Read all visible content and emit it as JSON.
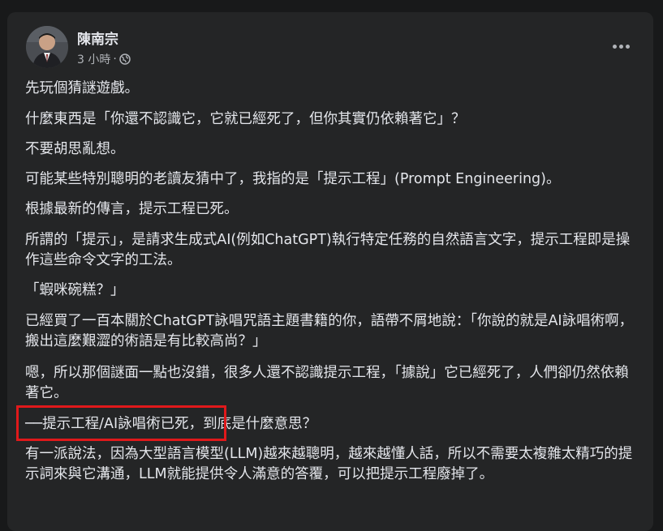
{
  "author": {
    "name": "陳南宗",
    "time": "3 小時",
    "separator": "·",
    "privacy_icon": "globe-icon"
  },
  "menu_icon": "more-options-icon",
  "paragraphs": [
    "先玩個猜謎遊戲。",
    "什麼東西是「你還不認識它，它就已經死了，但你其實仍依賴著它」？",
    "不要胡思亂想。",
    "可能某些特別聰明的老讀友猜中了，我指的是「提示工程」(Prompt Engineering)。",
    "根據最新的傳言，提示工程已死。",
    "所謂的「提示」，是請求生成式AI(例如ChatGPT)執行特定任務的自然語言文字，提示工程即是操作這些命令文字的工法。",
    "「蝦咪碗糕？」",
    "已經買了一百本關於ChatGPT詠唱咒語主題書籍的你，語帶不屑地說：「你說的就是AI詠唱術啊，搬出這麼艱澀的術語是有比較高尚？」",
    "嗯，所以那個謎面一點也沒錯，很多人還不認識提示工程，「據說」它已經死了，人們卻仍然依賴著它。",
    "──提示工程/AI詠唱術已死，到底是什麼意思？",
    "有一派說法，因為大型語言模型(LLM)越來越聰明，越來越懂人話，所以不需要太複雜太精巧的提示詞來與它溝通，LLM就能提供令人滿意的答覆，可以把提示工程廢掉了。"
  ],
  "colors": {
    "page_bg": "#18191a",
    "card_bg": "#242526",
    "text": "#e4e6eb",
    "secondary": "#b0b3b8",
    "highlight_border": "#e0191b"
  }
}
